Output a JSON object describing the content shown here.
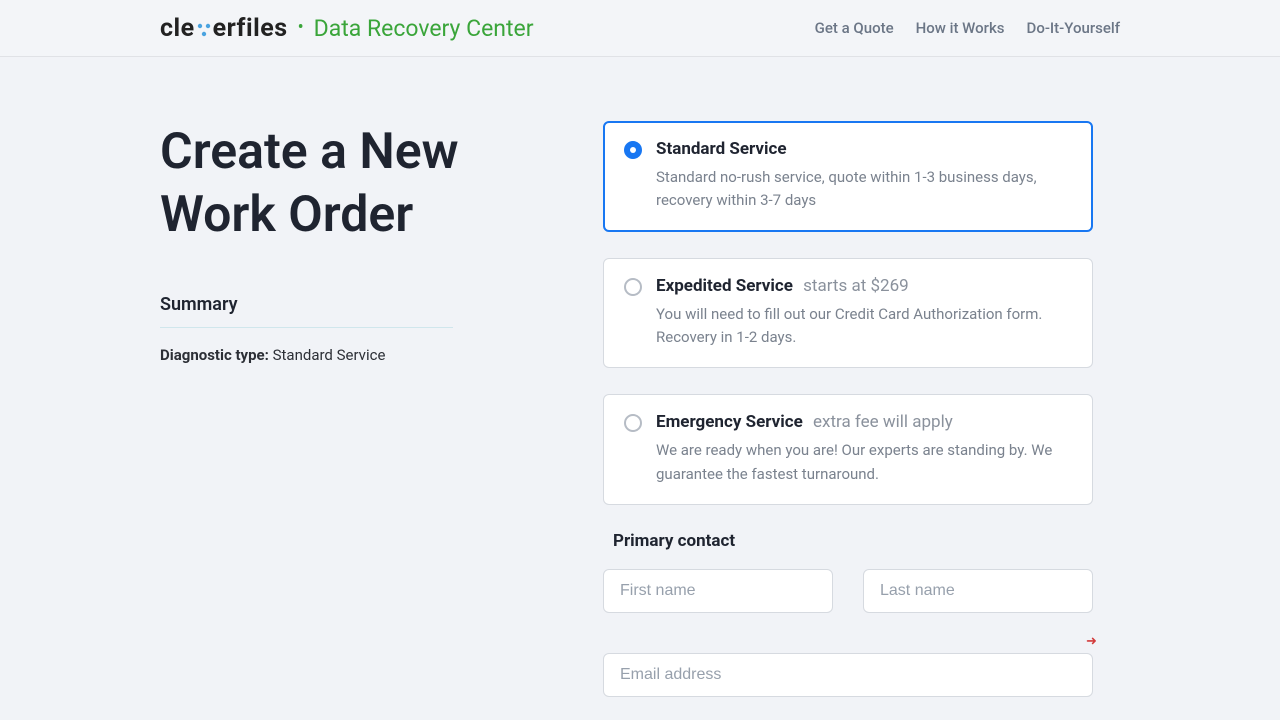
{
  "brand": {
    "name_pre": "cle",
    "name_post": "erfiles",
    "tagline": "Data Recovery Center"
  },
  "nav": {
    "quote": "Get a Quote",
    "how": "How it Works",
    "diy": "Do-It-Yourself"
  },
  "page": {
    "title": "Create a New Work Order"
  },
  "summary": {
    "heading": "Summary",
    "diag_label": "Diagnostic type:",
    "diag_value": "Standard Service"
  },
  "options": {
    "standard": {
      "title": "Standard Service",
      "desc": "Standard no-rush service, quote within 1-3 business days, recovery within 3-7 days"
    },
    "expedited": {
      "title": "Expedited Service",
      "sub": "starts at $269",
      "desc": "You will need to fill out our Credit Card Authorization form. Recovery in 1-2 days."
    },
    "emergency": {
      "title": "Emergency Service",
      "sub": "extra fee will apply",
      "desc": "We are ready when you are! Our experts are standing by. We guarantee the fastest turnaround."
    }
  },
  "contact": {
    "heading": "Primary contact",
    "first_placeholder": "First name",
    "last_placeholder": "Last name",
    "email_placeholder": "Email address"
  }
}
